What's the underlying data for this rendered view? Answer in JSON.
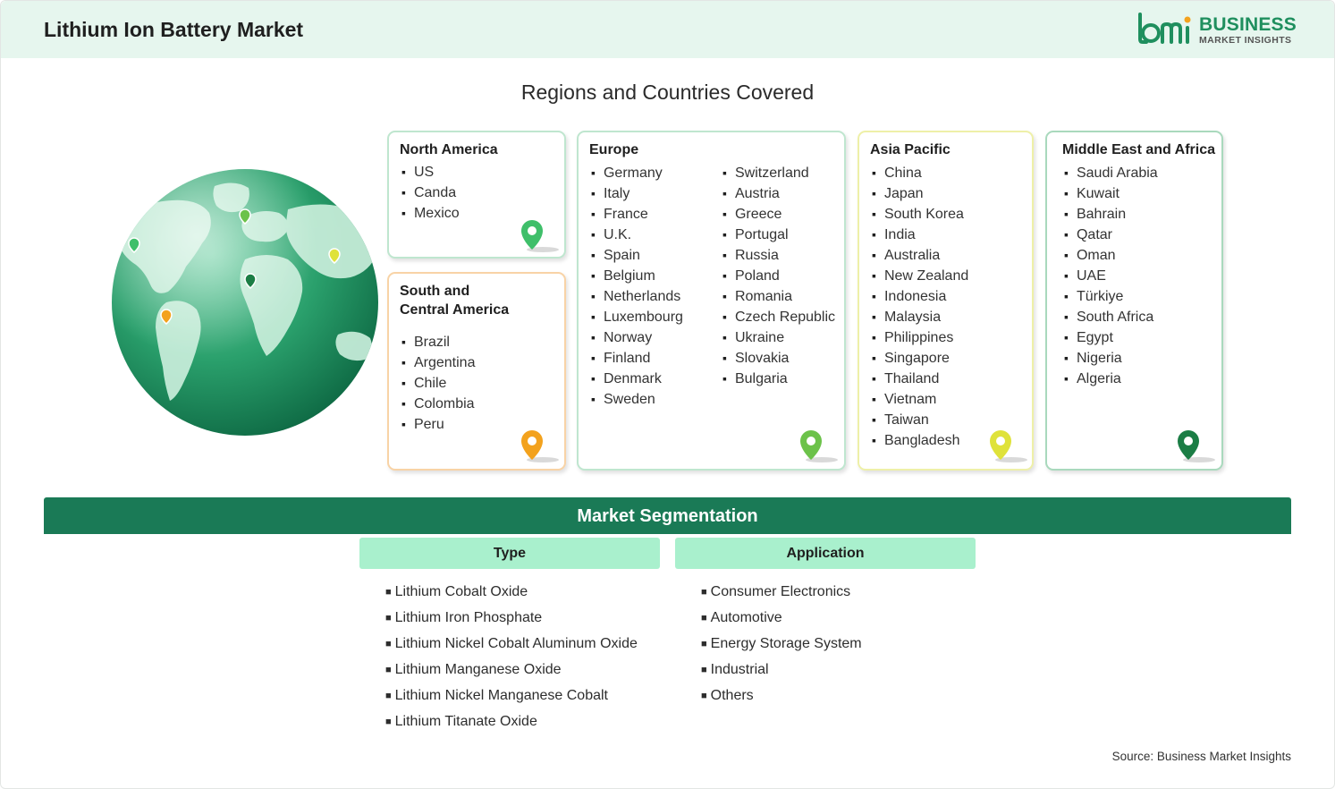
{
  "header": {
    "title": "Lithium Ion Battery Market",
    "logo_text": "BUSINESS",
    "logo_subtext": "MARKET INSIGHTS"
  },
  "regions_title": "Regions and Countries Covered",
  "regions": {
    "north_america": {
      "title": "North America",
      "countries": [
        "US",
        "Canda",
        "Mexico"
      ],
      "pin_color": "#3fbf6a"
    },
    "south_central_america": {
      "title_line1": "South and",
      "title_line2": "Central America",
      "countries": [
        "Brazil",
        "Argentina",
        "Chile",
        "Colombia",
        "Peru"
      ],
      "pin_color": "#f3a21d"
    },
    "europe": {
      "title": "Europe",
      "countries_col1": [
        "Germany",
        "Italy",
        "France",
        "U.K.",
        "Spain",
        "Belgium",
        "Netherlands",
        "Luxembourg",
        "Norway",
        "Finland",
        "Denmark",
        "Sweden"
      ],
      "countries_col2": [
        "Switzerland",
        "Austria",
        "Greece",
        "Portugal",
        "Russia",
        "Poland",
        "Romania",
        "Czech Republic",
        "Ukraine",
        "Slovakia",
        "Bulgaria"
      ],
      "pin_color": "#6cc24a"
    },
    "asia_pacific": {
      "title": "Asia Pacific",
      "countries": [
        "China",
        "Japan",
        "South Korea",
        "India",
        "Australia",
        "New Zealand",
        "Indonesia",
        "Malaysia",
        "Philippines",
        "Singapore",
        "Thailand",
        "Vietnam",
        "Taiwan",
        "Bangladesh"
      ],
      "pin_color": "#dfe23a"
    },
    "middle_east_africa": {
      "title": "Middle East and Africa",
      "countries": [
        "Saudi Arabia",
        "Kuwait",
        "Bahrain",
        "Qatar",
        "Oman",
        "UAE",
        "Türkiye",
        "South Africa",
        "Egypt",
        "Nigeria",
        "Algeria"
      ],
      "pin_color": "#1b7d45"
    }
  },
  "segmentation": {
    "title": "Market Segmentation",
    "type": {
      "heading": "Type",
      "items": [
        "Lithium Cobalt Oxide",
        "Lithium Iron Phosphate",
        "Lithium Nickel Cobalt Aluminum Oxide",
        "Lithium Manganese Oxide",
        "Lithium Nickel Manganese Cobalt",
        "Lithium Titanate Oxide"
      ]
    },
    "application": {
      "heading": "Application",
      "items": [
        "Consumer Electronics",
        "Automotive",
        "Energy Storage System",
        "Industrial",
        "Others"
      ]
    }
  },
  "source": "Source: Business Market Insights",
  "icons": {
    "globe": "globe-icon",
    "pin": "map-pin-icon",
    "logo": "bmi-logo-icon"
  },
  "colors": {
    "header_bg": "#e6f6ee",
    "segmentation_bar": "#1a7a56",
    "segment_heading_bg": "#a9f0cd",
    "brand_green": "#1f8f5e"
  }
}
